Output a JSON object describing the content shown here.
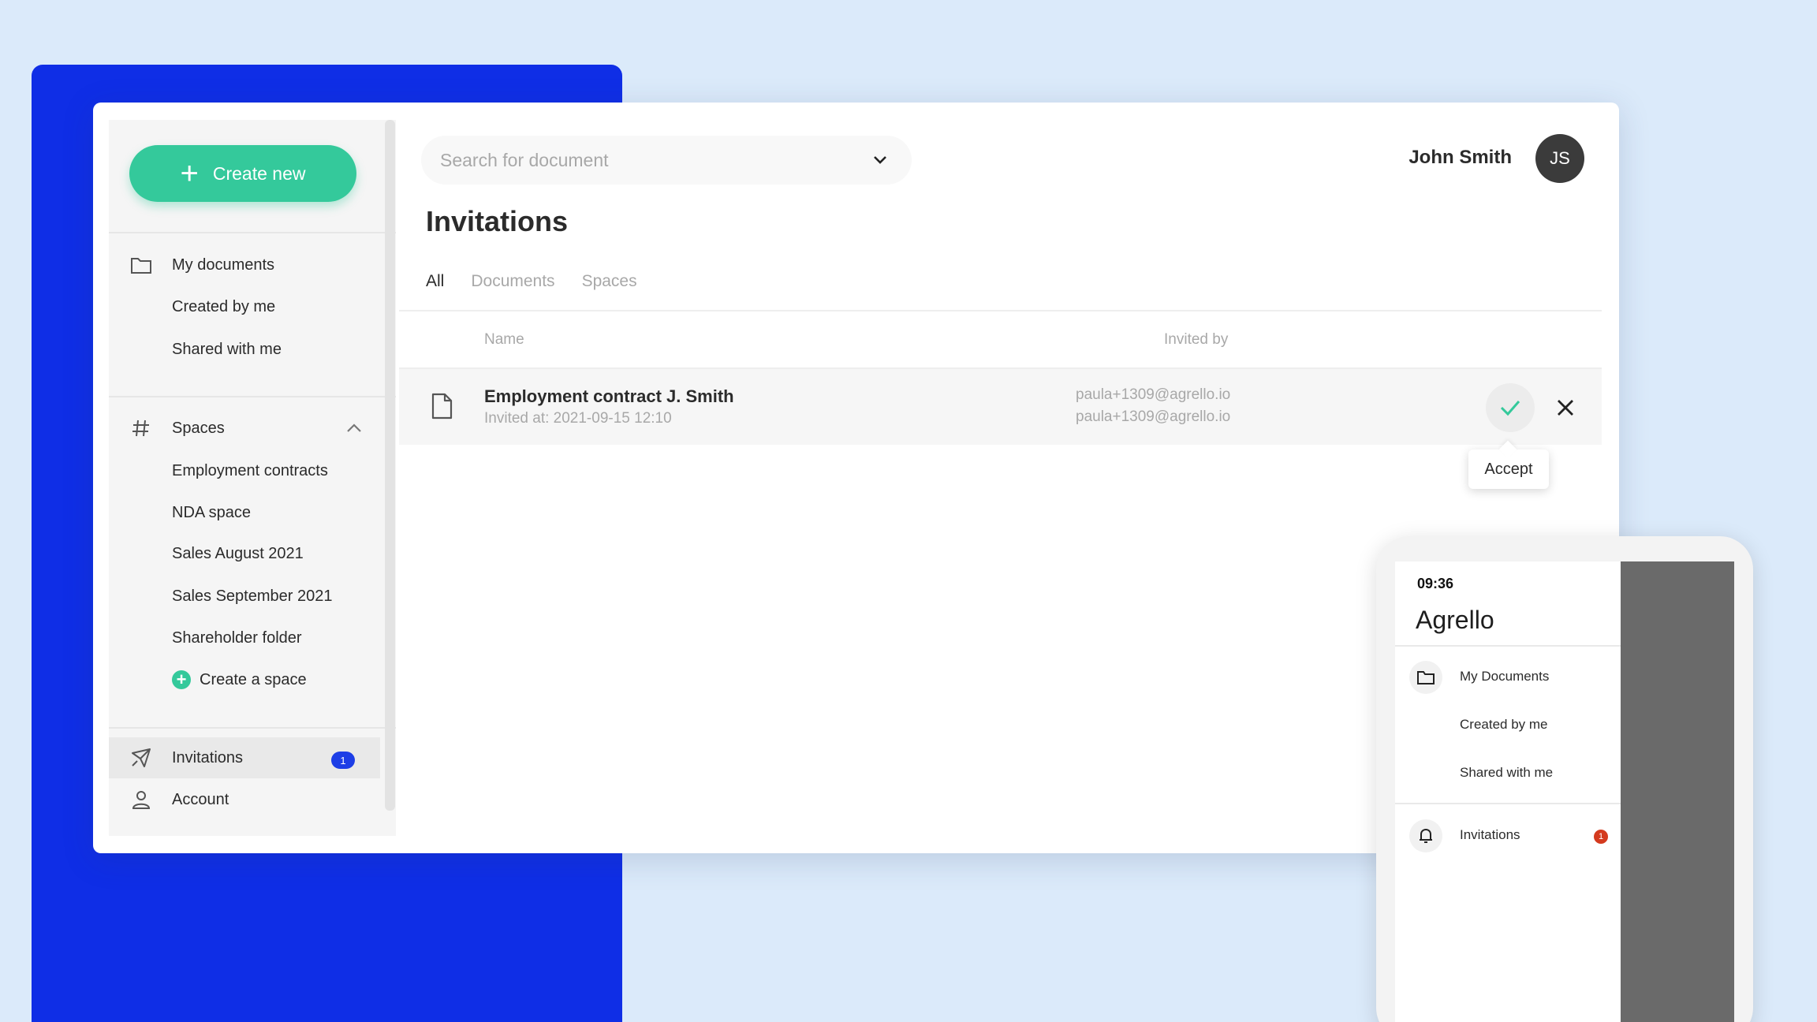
{
  "sidebar": {
    "create_new_label": "Create new",
    "my_documents": "My documents",
    "created_by_me": "Created by me",
    "shared_with_me": "Shared with me",
    "spaces_label": "Spaces",
    "spaces": [
      "Employment contracts",
      "NDA space",
      "Sales August 2021",
      "Sales September 2021",
      "Shareholder folder"
    ],
    "create_space": "Create a space",
    "invitations": "Invitations",
    "invitations_badge": "1",
    "account": "Account"
  },
  "header": {
    "search_placeholder": "Search for document",
    "user_name": "John Smith",
    "avatar_initials": "JS"
  },
  "main": {
    "title": "Invitations",
    "tabs": [
      "All",
      "Documents",
      "Spaces"
    ],
    "active_tab": "All",
    "columns": {
      "name": "Name",
      "invited_by": "Invited by"
    },
    "rows": [
      {
        "name": "Employment contract J. Smith",
        "invited_at": "Invited at: 2021-09-15 12:10",
        "invited_by_1": "paula+1309@agrello.io",
        "invited_by_2": "paula+1309@agrello.io"
      }
    ],
    "accept_tooltip": "Accept"
  },
  "phone": {
    "time": "09:36",
    "logo": "Agrello",
    "my_documents": "My Documents",
    "created_by_me": "Created by me",
    "shared_with_me": "Shared with me",
    "invitations": "Invitations",
    "invitations_badge": "1"
  },
  "colors": {
    "accent_green": "#34c99b",
    "brand_blue": "#0f2ee6",
    "badge_blue": "#1d3ee6",
    "badge_red": "#d43a1e",
    "background": "#dbeafa"
  },
  "icons": {
    "folder": "folder-icon",
    "hash": "hash-icon",
    "plus": "plus-icon",
    "invitation": "paper-plane-icon",
    "account": "person-icon",
    "document": "document-icon",
    "check": "check-icon",
    "close": "close-icon",
    "bell": "bell-icon",
    "chevron_down": "chevron-down-icon",
    "chevron_up": "chevron-up-icon"
  }
}
